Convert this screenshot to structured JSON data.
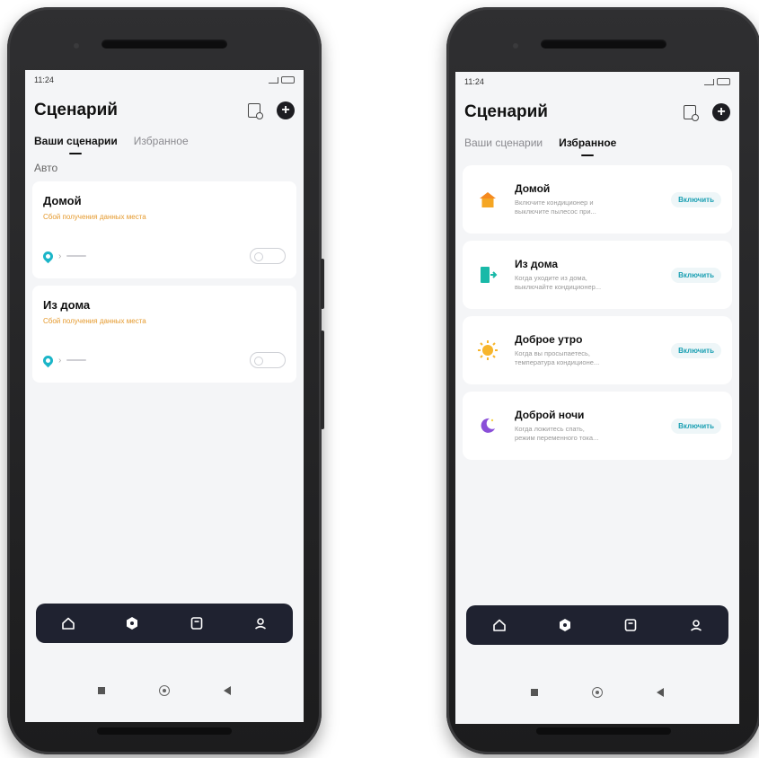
{
  "left_phone": {
    "status_time": "11:24",
    "title": "Сценарий",
    "tabs": [
      "Ваши сценарии",
      "Избранное"
    ],
    "section_label": "Авто",
    "scenes": [
      {
        "name": "Домой",
        "error": "Сбой получения данных места"
      },
      {
        "name": "Из дома",
        "error": "Сбой получения данных места"
      }
    ]
  },
  "right_phone": {
    "status_time": "11:24",
    "title": "Сценарий",
    "tabs": [
      "Ваши сценарии",
      "Избранное"
    ],
    "favorites": [
      {
        "name": "Домой",
        "desc1": "Включите кондиционер и",
        "desc2": "выключите пылесос при...",
        "button": "Включить",
        "icon": "house-icon"
      },
      {
        "name": "Из дома",
        "desc1": "Когда уходите из дома,",
        "desc2": "выключайте кондиционер...",
        "button": "Включить",
        "icon": "door-exit-icon"
      },
      {
        "name": "Доброе утро",
        "desc1": "Когда вы просыпаетесь,",
        "desc2": "температура кондиционе...",
        "button": "Включить",
        "icon": "sun-icon"
      },
      {
        "name": "Доброй ночи",
        "desc1": "Когда ложитесь спать,",
        "desc2": "режим переменного тока...",
        "button": "Включить",
        "icon": "moon-icon"
      }
    ]
  },
  "colors": {
    "accent": "#1bb5c8",
    "warning": "#e59a2e",
    "nav_bg": "#1f2230",
    "house": "#f5a623",
    "door": "#19b9a8",
    "sun": "#f7b52c",
    "moon": "#8a4fd8"
  }
}
